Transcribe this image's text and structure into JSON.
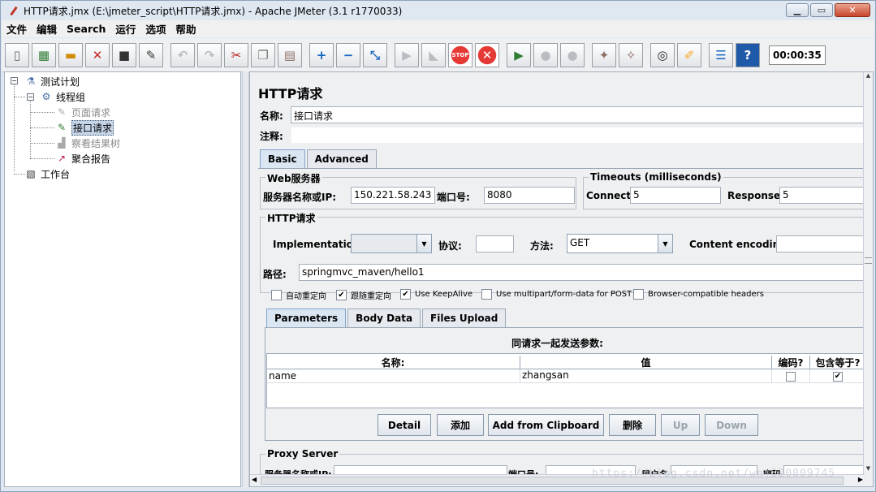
{
  "window": {
    "title": "HTTP请求.jmx (E:\\jmeter_script\\HTTP请求.jmx) - Apache JMeter (3.1 r1770033)"
  },
  "menu": [
    "文件",
    "编辑",
    "Search",
    "运行",
    "选项",
    "帮助"
  ],
  "toolbar": {
    "buttons": [
      "new-icon",
      "templates-icon",
      "open-icon",
      "close-icon",
      "save-icon",
      "save-as-icon",
      "undo-icon",
      "redo-icon",
      "cut-icon",
      "copy-icon",
      "paste-icon",
      "expand-icon",
      "collapse-icon",
      "toggle-icon",
      "start-icon",
      "start-no-pause-icon",
      "stop-icon",
      "shutdown-icon",
      "remote-start-icon",
      "remote-stop-icon",
      "remote-shutdown-icon",
      "clear-icon",
      "clear-all-icon",
      "search-icon",
      "reset-search-icon",
      "function-helper-icon",
      "help-icon"
    ],
    "timer": "00:00:35"
  },
  "tree": {
    "root": "测试计划",
    "thread_group": "线程组",
    "items": [
      "页面请求",
      "接口请求",
      "察看结果树",
      "聚合报告"
    ],
    "workbench": "工作台"
  },
  "panel": {
    "title": "HTTP请求",
    "name_label": "名称:",
    "name_value": "接口请求",
    "comment_label": "注释:",
    "comment_value": "",
    "tabs": [
      "Basic",
      "Advanced"
    ],
    "web_server": {
      "title": "Web服务器",
      "server_label": "服务器名称或IP:",
      "server_value": "150.221.58.243",
      "port_label": "端口号:",
      "port_value": "8080"
    },
    "timeouts": {
      "title": "Timeouts (milliseconds)",
      "connect_label": "Connect:",
      "connect_value": "5",
      "response_label": "Response:",
      "response_value": "5"
    },
    "http_request": {
      "title": "HTTP请求",
      "impl_label": "Implementation:",
      "impl_value": "",
      "protocol_label": "协议:",
      "protocol_value": "",
      "method_label": "方法:",
      "method_value": "GET",
      "encoding_label": "Content encoding:",
      "encoding_value": "",
      "path_label": "路径:",
      "path_value": "springmvc_maven/hello1"
    },
    "checkboxes": [
      {
        "label": "自动重定向",
        "checked": false
      },
      {
        "label": "跟随重定向",
        "checked": true
      },
      {
        "label": "Use KeepAlive",
        "checked": true
      },
      {
        "label": "Use multipart/form-data for POST",
        "checked": false
      },
      {
        "label": "Browser-compatible headers",
        "checked": false
      }
    ],
    "subtabs": [
      "Parameters",
      "Body Data",
      "Files Upload"
    ],
    "params": {
      "caption": "同请求一起发送参数:",
      "headers": [
        "名称:",
        "值",
        "编码?",
        "包含等于?"
      ],
      "rows": [
        {
          "name": "name",
          "value": "zhangsan",
          "encode": false,
          "include_equals": true
        }
      ]
    },
    "buttons": {
      "detail": "Detail",
      "add": "添加",
      "clipboard": "Add from Clipboard",
      "delete": "删除",
      "up": "Up",
      "down": "Down"
    },
    "proxy": {
      "title": "Proxy Server",
      "server_label": "服务器名称或IP:",
      "port_label": "端口号:",
      "user_label": "用户名",
      "password_label": "密码"
    }
  },
  "watermark": "https://blog.csdn.net/wnj320009745"
}
